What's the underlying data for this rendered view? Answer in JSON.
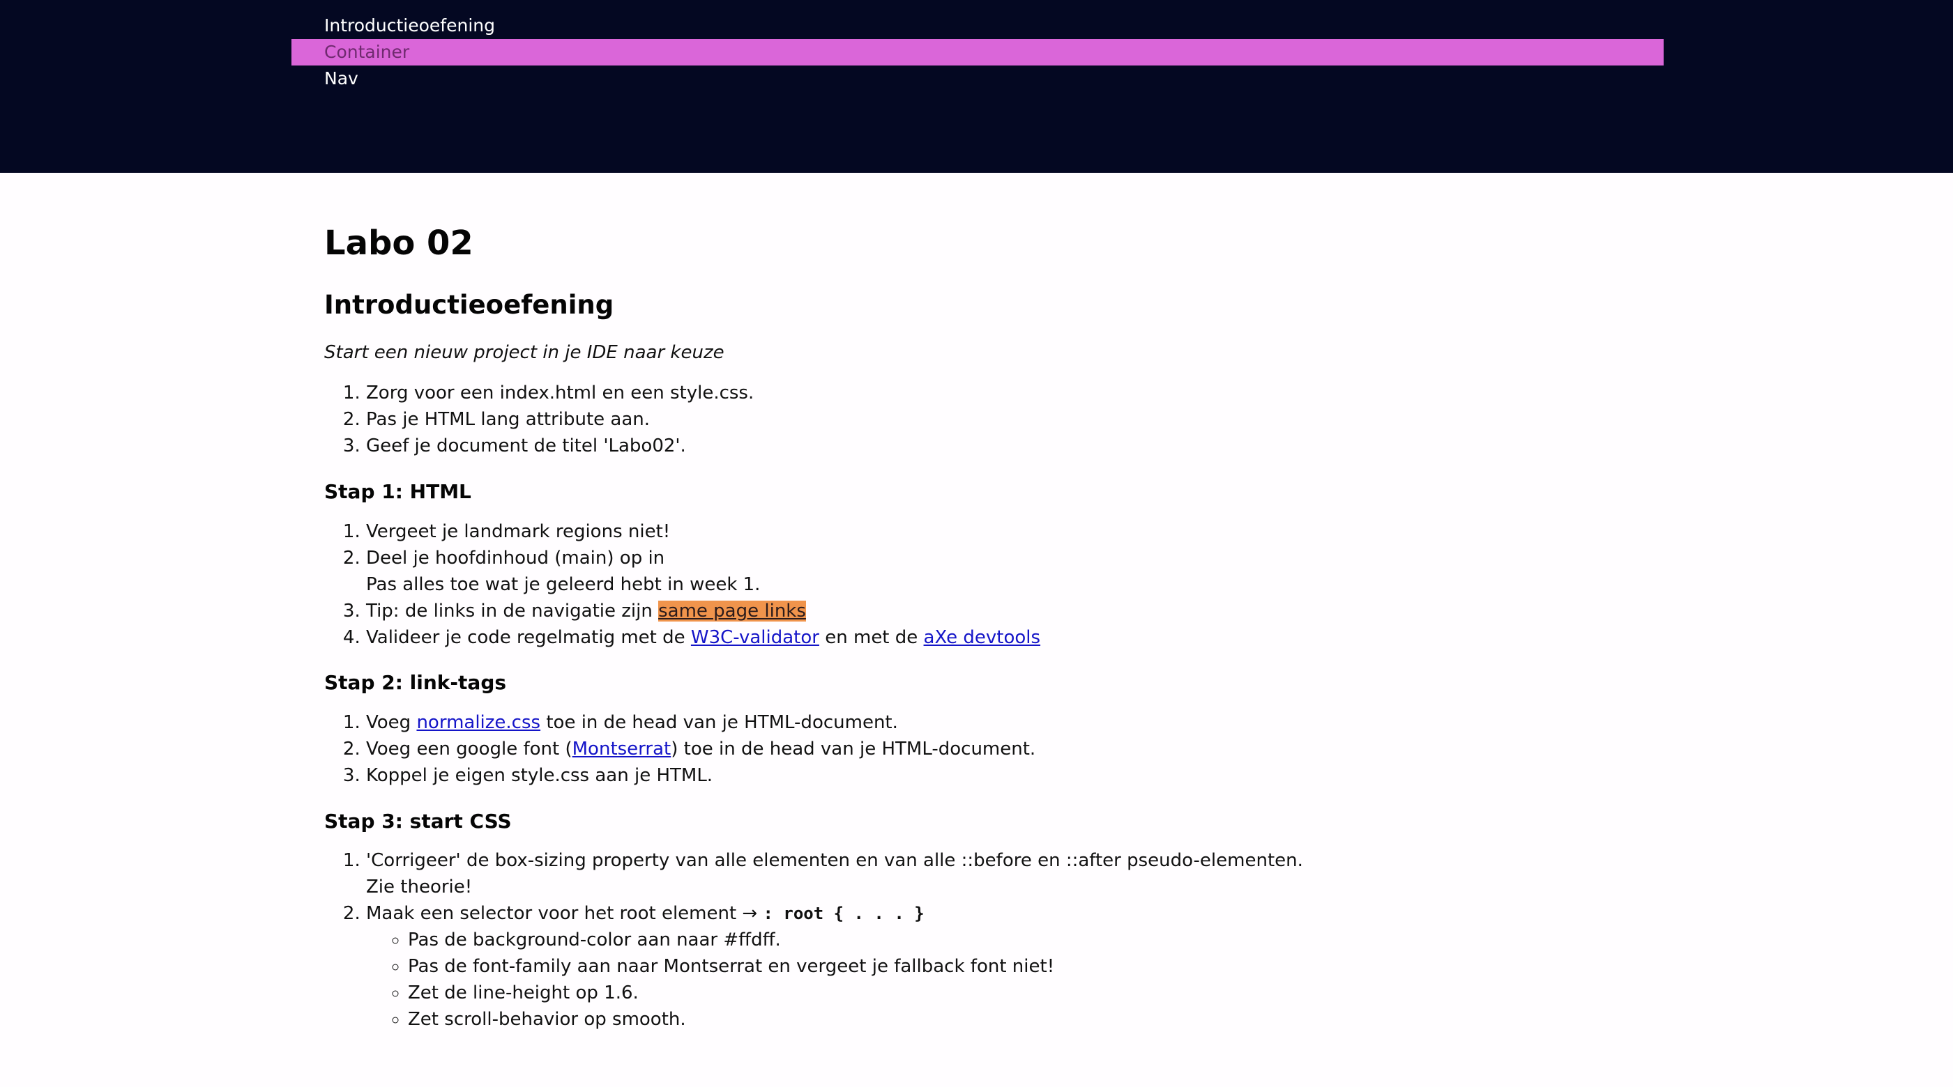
{
  "nav": {
    "items": [
      {
        "label": "Introductieoefening"
      },
      {
        "label": "Container"
      },
      {
        "label": "Nav"
      }
    ]
  },
  "main": {
    "title": "Labo 02",
    "intro_section": {
      "heading": "Introductieoefening",
      "subtitle": "Start een nieuw project in je IDE naar keuze",
      "items": [
        "Zorg voor een index.html en een style.css.",
        "Pas je HTML lang attribute aan.",
        "Geef je document de titel 'Labo02'."
      ]
    },
    "step1": {
      "heading": "Stap 1: HTML",
      "item1": "Vergeet je landmark regions niet!",
      "item2_line1": "Deel je hoofdinhoud (main) op in",
      "item2_line2": "Pas alles toe wat je geleerd hebt in week 1.",
      "item3_text": "Tip: de links in de navigatie zijn ",
      "item3_link": "same page links",
      "item4_text": "Valideer je code regelmatig met de ",
      "item4_link1": "W3C-validator",
      "item4_mid": " en met de ",
      "item4_link2": "aXe devtools"
    },
    "step2": {
      "heading": "Stap 2: link-tags",
      "item1_pre": "Voeg ",
      "item1_link": "normalize.css",
      "item1_post": " toe in de head van je HTML-document.",
      "item2_pre": "Voeg een google font (",
      "item2_link": "Montserrat",
      "item2_post": ") toe in de head van je HTML-document.",
      "item3": "Koppel je eigen style.css aan je HTML."
    },
    "step3": {
      "heading": "Stap 3: start CSS",
      "item1_line1": "'Corrigeer' de box-sizing property van alle elementen en van alle ::before en ::after pseudo-elementen.",
      "item1_line2": "Zie theorie!",
      "item2_text": "Maak een selector voor het root element → ",
      "item2_code": ": root { . . . }",
      "sub_items": [
        "Pas de background-color aan naar #ffdff.",
        "Pas de font-family aan naar Montserrat en vergeet je fallback font niet!",
        "Zet de line-height op 1.6.",
        "Zet scroll-behavior op smooth."
      ]
    }
  },
  "colors": {
    "header_bg": "#040822",
    "nav_active_bg": "#da66d9",
    "link": "#1414c8",
    "link_highlight_bg": "#f0944c"
  }
}
